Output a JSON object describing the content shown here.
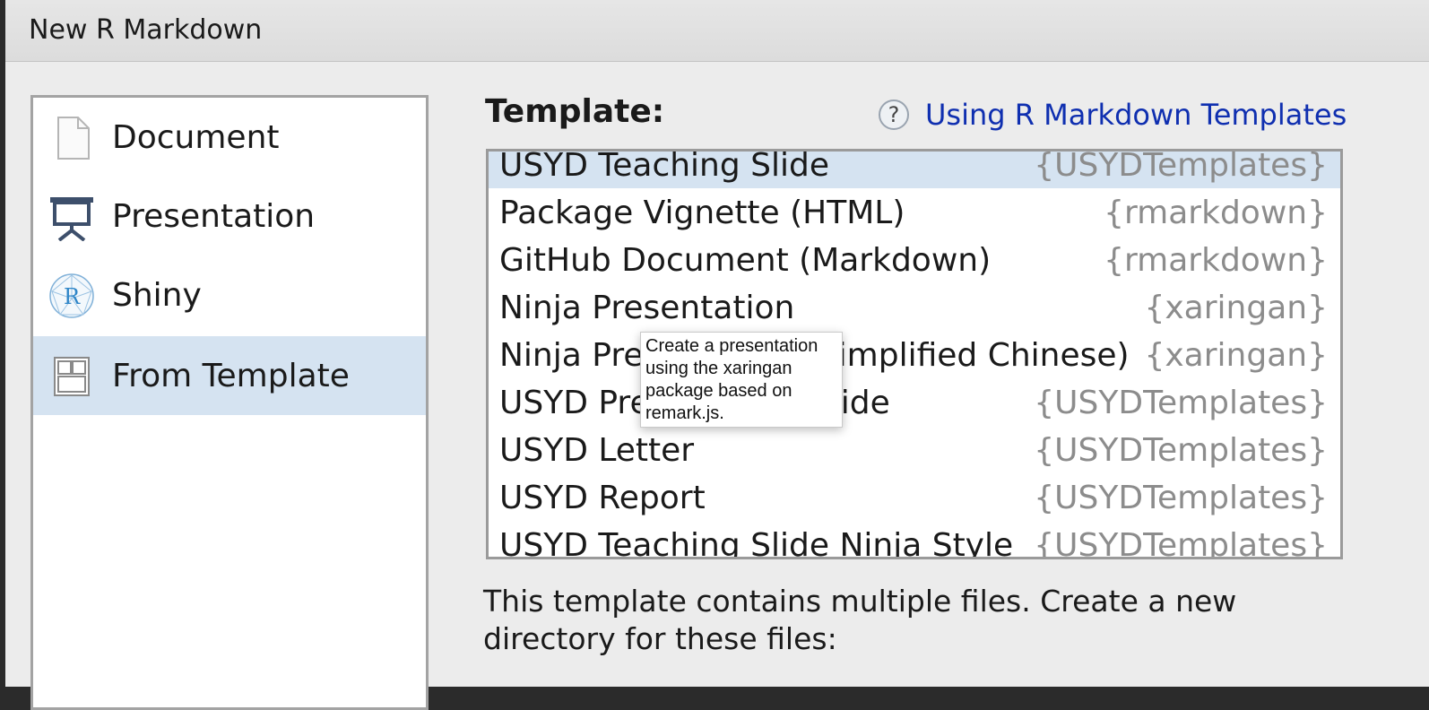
{
  "window": {
    "title": "New R Markdown"
  },
  "sidebar": {
    "items": [
      {
        "label": "Document",
        "icon": "document-icon",
        "selected": false
      },
      {
        "label": "Presentation",
        "icon": "presentation-icon",
        "selected": false
      },
      {
        "label": "Shiny",
        "icon": "shiny-icon",
        "selected": false
      },
      {
        "label": "From Template",
        "icon": "template-icon",
        "selected": true
      }
    ]
  },
  "template": {
    "label": "Template:",
    "help_link": "Using R Markdown Templates",
    "help_icon": "?",
    "rows": [
      {
        "name": "USYD Teaching Slide",
        "package": "{USYDTemplates}",
        "selected": true
      },
      {
        "name": "Package Vignette (HTML)",
        "package": "{rmarkdown}",
        "selected": false
      },
      {
        "name": "GitHub Document (Markdown)",
        "package": "{rmarkdown}",
        "selected": false
      },
      {
        "name": "Ninja Presentation",
        "package": "{xaringan}",
        "selected": false
      },
      {
        "name": "Ninja Presentation (Simplified Chinese)",
        "package": "{xaringan}",
        "selected": false
      },
      {
        "name": "USYD Presentation Slide",
        "package": "{USYDTemplates}",
        "selected": false
      },
      {
        "name": "USYD Letter",
        "package": "{USYDTemplates}",
        "selected": false
      },
      {
        "name": "USYD Report",
        "package": "{USYDTemplates}",
        "selected": false
      },
      {
        "name": "USYD Teaching Slide Ninja Style",
        "package": "{USYDTemplates}",
        "selected": false
      }
    ]
  },
  "tooltip": {
    "lines": [
      "Create a presentation",
      "using the xaringan",
      "package based on",
      "remark.js."
    ]
  },
  "description": "This template contains multiple files. Create a new directory for these files:",
  "colors": {
    "selection": "#d5e3f1",
    "link": "#0f2fb0",
    "package_text": "#8c8c8c"
  }
}
